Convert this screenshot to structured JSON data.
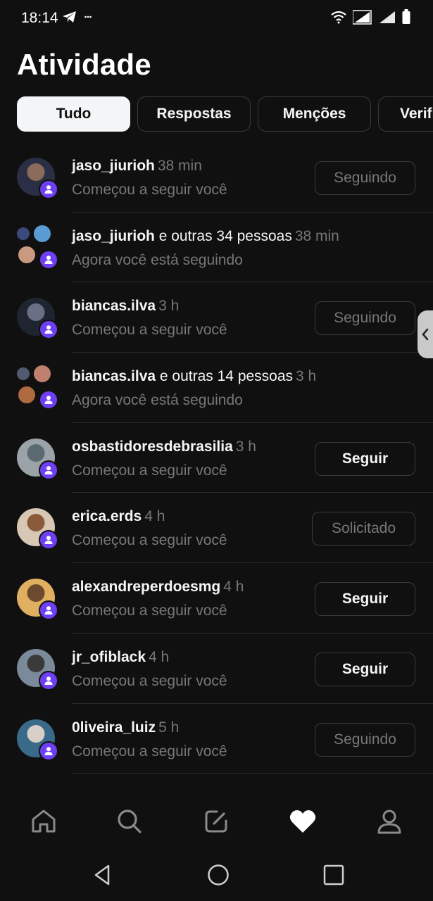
{
  "status_bar": {
    "time": "18:14",
    "icons": [
      "telegram-icon",
      "more-icon",
      "wifi-icon",
      "signal-icon",
      "signal-2-icon",
      "battery-icon"
    ]
  },
  "page": {
    "title": "Atividade"
  },
  "tabs": [
    {
      "label": "Tudo",
      "active": true
    },
    {
      "label": "Respostas",
      "active": false
    },
    {
      "label": "Menções",
      "active": false
    },
    {
      "label": "Verifi",
      "active": false
    }
  ],
  "activities": [
    {
      "user": "jaso_jiurioh",
      "suffix": "",
      "time": "38 min",
      "text": "Começou a seguir você",
      "button": "Seguindo",
      "button_style": "muted",
      "avatar": "single",
      "colors": [
        "#2a2f45",
        "#8b6b5a"
      ]
    },
    {
      "user": "jaso_jiurioh",
      "suffix": " e outras 34 pessoas",
      "time": "38 min",
      "text": "Agora você está seguindo",
      "button": "",
      "button_style": "",
      "avatar": "group",
      "colors": [
        "#3b4a7a",
        "#5a9bd6",
        "#c99a80"
      ]
    },
    {
      "user": "biancas.ilva",
      "suffix": "",
      "time": "3 h",
      "text": "Começou a seguir você",
      "button": "Seguindo",
      "button_style": "muted",
      "avatar": "single",
      "colors": [
        "#1f2530",
        "#6b6f86"
      ]
    },
    {
      "user": "biancas.ilva",
      "suffix": " e outras 14 pessoas",
      "time": "3 h",
      "text": "Agora você está seguindo",
      "button": "",
      "button_style": "",
      "avatar": "group",
      "colors": [
        "#505a70",
        "#c08070",
        "#b06a40"
      ]
    },
    {
      "user": "osbastidoresdebrasilia",
      "suffix": "",
      "time": "3 h",
      "text": "Começou a seguir você",
      "button": "Seguir",
      "button_style": "strong",
      "avatar": "single",
      "colors": [
        "#9aa3a8",
        "#5a6a70"
      ]
    },
    {
      "user": "erica.erds",
      "suffix": "",
      "time": "4 h",
      "text": "Começou a seguir você",
      "button": "Solicitado",
      "button_style": "muted",
      "avatar": "single",
      "colors": [
        "#d9c7b5",
        "#8a5a3a"
      ]
    },
    {
      "user": "alexandreperdoesmg",
      "suffix": "",
      "time": "4 h",
      "text": "Começou a seguir você",
      "button": "Seguir",
      "button_style": "strong",
      "avatar": "single",
      "colors": [
        "#e0b060",
        "#6b4a30"
      ]
    },
    {
      "user": "jr_ofiblack",
      "suffix": "",
      "time": "4 h",
      "text": "Começou a seguir você",
      "button": "Seguir",
      "button_style": "strong",
      "avatar": "single",
      "colors": [
        "#7a8a9a",
        "#3a3a3a"
      ]
    },
    {
      "user": "0liveira_luiz",
      "suffix": "",
      "time": "5 h",
      "text": "Começou a seguir você",
      "button": "Seguindo",
      "button_style": "muted",
      "avatar": "single",
      "colors": [
        "#3a6a8a",
        "#d8d0c8"
      ]
    }
  ],
  "bottom_nav": [
    {
      "name": "home-icon",
      "active": false
    },
    {
      "name": "search-icon",
      "active": false
    },
    {
      "name": "compose-icon",
      "active": false
    },
    {
      "name": "heart-icon",
      "active": true
    },
    {
      "name": "profile-icon",
      "active": false
    }
  ],
  "system_nav": [
    "back-icon",
    "home-circle-icon",
    "recents-icon"
  ],
  "colors": {
    "background": "#101010",
    "text": "#f3f5f7",
    "muted": "#777777",
    "badge": "#6e3ff3",
    "border": "#3a3a3a"
  }
}
